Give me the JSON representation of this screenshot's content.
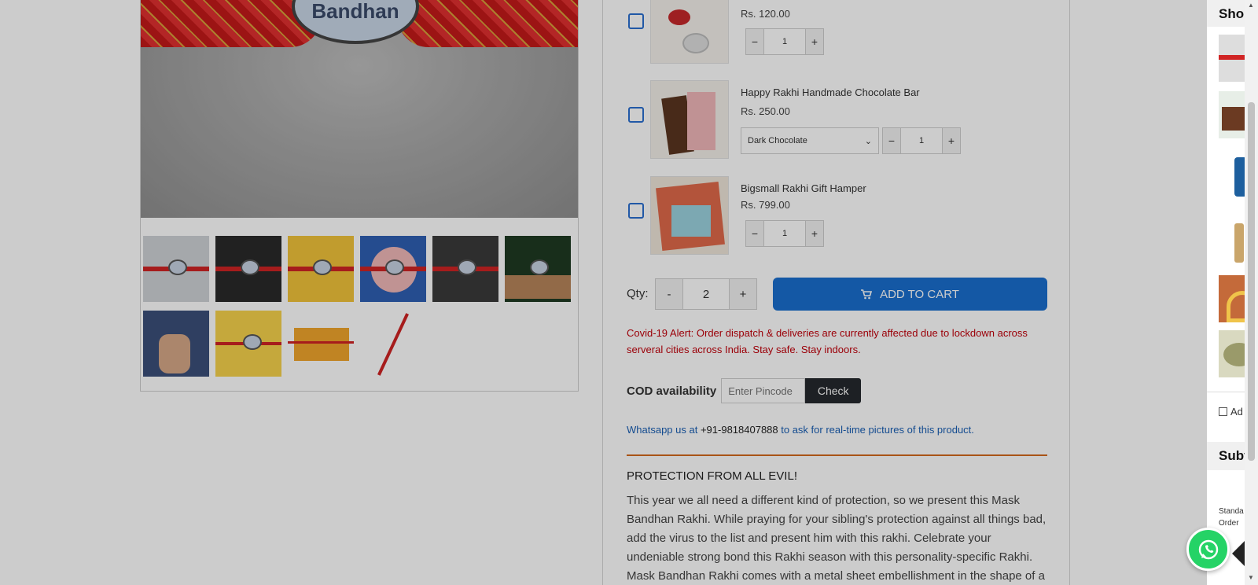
{
  "gallery": {
    "main_charm_text": "Bandhan",
    "thumb_count": 10
  },
  "addons": [
    {
      "name": "",
      "price": "Rs. 120.00",
      "qty": "1"
    },
    {
      "name": "Happy Rakhi Handmade Chocolate Bar",
      "price": "Rs. 250.00",
      "variant": "Dark Chocolate",
      "qty": "1"
    },
    {
      "name": "Bigsmall Rakhi Gift Hamper",
      "price": "Rs. 799.00",
      "qty": "1"
    }
  ],
  "purchase": {
    "qty_label": "Qty:",
    "qty_minus": "-",
    "qty_value": "2",
    "qty_plus": "+",
    "add_to_cart": "ADD TO CART"
  },
  "alert": "Covid-19 Alert: Order dispatch & deliveries are currently affected due to lockdown across serveral cities across India. Stay safe. Stay indoors.",
  "cod": {
    "label": "COD availability",
    "placeholder": "Enter Pincode",
    "check": "Check"
  },
  "whatsapp_line": {
    "prefix": "Whatsapp us at ",
    "number": "+91-9818407888",
    "suffix": " to ask for real-time pictures of this product."
  },
  "description": {
    "heading": "PROTECTION FROM ALL EVIL!",
    "body": "This year we all need a different kind of protection, so we present this Mask Bandhan Rakhi. While praying for your sibling's protection against all things bad, add the virus to the list and present him with this rakhi. Celebrate your undeniable strong bond this Rakhi season with this personality-specific Rakhi. Mask Bandhan Rakhi comes with a metal sheet embellishment in the shape of a face mask."
  },
  "cart_panel": {
    "heading": "Shop",
    "accessory_label": "Ad",
    "subtotal_heading": "Subt",
    "small_line1": "Standa",
    "small_line2": "Order"
  },
  "colors": {
    "primary_button": "#1a6fcf",
    "alert_red": "#c2000b",
    "link_blue": "#1a5fb4",
    "divider_orange": "#d46a1c",
    "whatsapp_green": "#25d366"
  }
}
